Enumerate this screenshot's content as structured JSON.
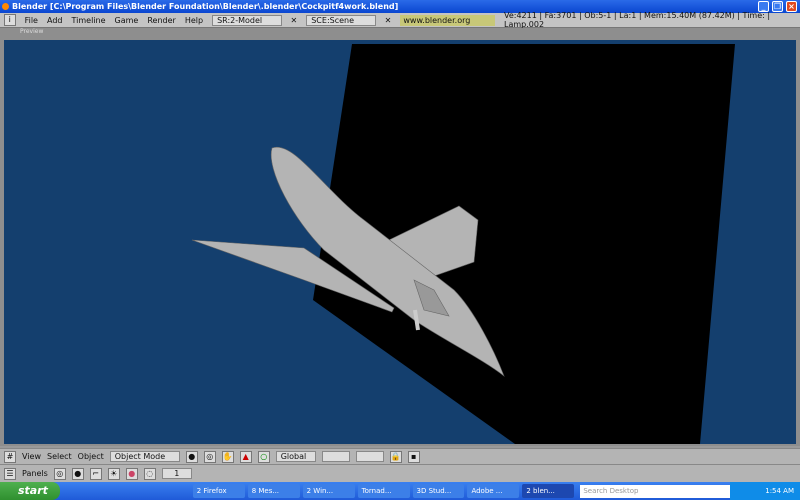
{
  "window": {
    "title": "Blender [C:\\Program Files\\Blender Foundation\\Blender\\.blender\\Cockpitf4work.blend]"
  },
  "menu": {
    "items": [
      "File",
      "Add",
      "Timeline",
      "Game",
      "Render",
      "Help"
    ],
    "screen": "SR:2-Model",
    "scene": "SCE:Scene",
    "url": "www.blender.org 248.1",
    "stats": "Ve:4211 | Fa:3701 | Ob:5-1 | La:1  | Mem:15.40M (87.42M)  | Time: | Lamp.002"
  },
  "preview": {
    "label": "Preview"
  },
  "viewport": {
    "background": "#143f6e",
    "plane_color": "#000000",
    "model_color": "#b0b0b0"
  },
  "header3d": {
    "items": [
      "View",
      "Select",
      "Object"
    ],
    "mode": "Object Mode",
    "orientation": "Global"
  },
  "buttons": {
    "label": "Panels",
    "frame": "1"
  },
  "taskbar": {
    "start": "start",
    "tasks": [
      "2 Firefox",
      "8 Mes...",
      "2 Win...",
      "Tornad...",
      "3D Stud...",
      "Adobe ...",
      "2 blen..."
    ],
    "search_placeholder": "Search Desktop",
    "clock": "1:54 AM"
  }
}
